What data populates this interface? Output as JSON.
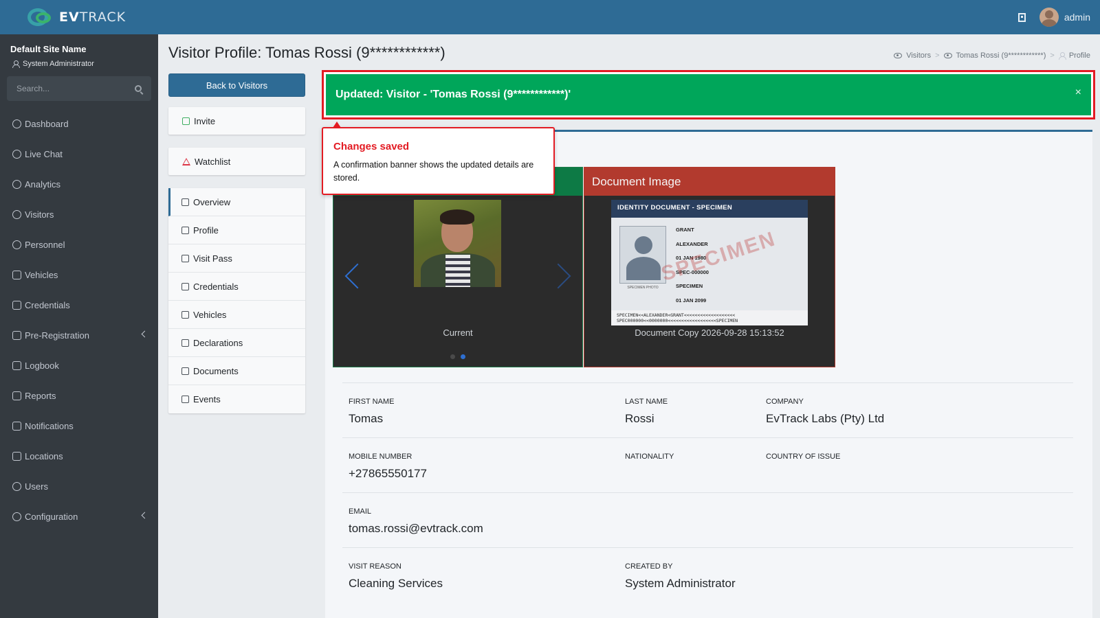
{
  "brand": {
    "logo_text_bold": "EV",
    "logo_text": "TRACK"
  },
  "topbar": {
    "user": "admin"
  },
  "sidebar": {
    "site_name": "Default Site Name",
    "role": "System Administrator",
    "search_placeholder": "Search...",
    "items": [
      {
        "label": "Dashboard"
      },
      {
        "label": "Live Chat"
      },
      {
        "label": "Analytics"
      },
      {
        "label": "Visitors"
      },
      {
        "label": "Personnel"
      },
      {
        "label": "Vehicles"
      },
      {
        "label": "Credentials"
      },
      {
        "label": "Pre-Registration"
      },
      {
        "label": "Logbook"
      },
      {
        "label": "Reports"
      },
      {
        "label": "Notifications"
      },
      {
        "label": "Locations"
      },
      {
        "label": "Users"
      },
      {
        "label": "Configuration"
      }
    ]
  },
  "page": {
    "title": "Visitor Profile: Tomas Rossi (9************)",
    "breadcrumb": {
      "visitors": "Visitors",
      "visitor": "Tomas Rossi (9************)",
      "current": "Profile"
    }
  },
  "left": {
    "back_label": "Back to Visitors",
    "invite_label": "Invite",
    "watchlist_label": "Watchlist",
    "menu": [
      {
        "label": "Overview"
      },
      {
        "label": "Profile"
      },
      {
        "label": "Visit Pass"
      },
      {
        "label": "Credentials"
      },
      {
        "label": "Vehicles"
      },
      {
        "label": "Declarations"
      },
      {
        "label": "Documents"
      },
      {
        "label": "Events"
      }
    ]
  },
  "alert": {
    "message": "Updated: Visitor - 'Tomas Rossi (9************)'",
    "close": "×"
  },
  "tooltip": {
    "title": "Changes saved",
    "body": "A confirmation banner shows the updated details are stored."
  },
  "photo": {
    "caption": "Current"
  },
  "document": {
    "header": "Document Image",
    "caption": "Document Copy 2026-09-28 15:13:52",
    "id_title": "IDENTITY DOCUMENT - SPECIMEN",
    "photo_label": "SPECIMEN PHOTO",
    "fields": [
      "GRANT",
      "ALEXANDER",
      "01 JAN 1980",
      "SPEC-000000",
      "SPECIMEN",
      "01 JAN 2099"
    ],
    "watermark": "SPECIMEN",
    "mrz1": "SPECIMEN<<ALEXANDER<GRANT<<<<<<<<<<<<<<<<<<<",
    "mrz2": "SPEC000000<<0000000<<<<<<<<<<<<<<<<<<SPECIMEN"
  },
  "details": {
    "first_name": {
      "label": "FIRST NAME",
      "value": "Tomas"
    },
    "last_name": {
      "label": "LAST NAME",
      "value": "Rossi"
    },
    "company": {
      "label": "COMPANY",
      "value": "EvTrack Labs (Pty) Ltd"
    },
    "mobile": {
      "label": "MOBILE NUMBER",
      "value": "+27865550177"
    },
    "nationality": {
      "label": "NATIONALITY",
      "value": ""
    },
    "country_of_issue": {
      "label": "COUNTRY OF ISSUE",
      "value": ""
    },
    "email": {
      "label": "EMAIL",
      "value": "tomas.rossi@evtrack.com"
    },
    "visit_reason": {
      "label": "VISIT REASON",
      "value": "Cleaning Services"
    },
    "created_by": {
      "label": "CREATED BY",
      "value": "System Administrator"
    }
  },
  "colors": {
    "primary": "#2e6b95",
    "success": "#00a65a",
    "danger": "#e31b23",
    "sidebar": "#343a40"
  }
}
